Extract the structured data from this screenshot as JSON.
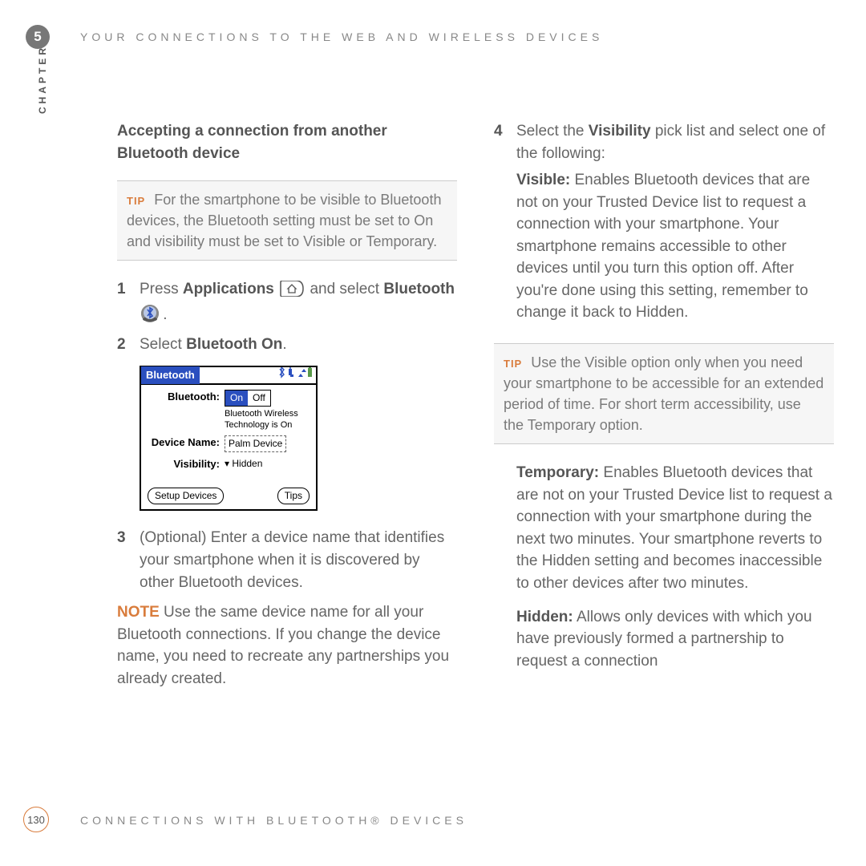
{
  "chapter_number": "5",
  "chapter_word": "CHAPTER",
  "running_header": "YOUR CONNECTIONS TO THE WEB AND WIRELESS DEVICES",
  "page_number": "130",
  "running_footer": "CONNECTIONS WITH BLUETOOTH® DEVICES",
  "left": {
    "heading": "Accepting a connection from another Bluetooth device",
    "tip_label": "TIP",
    "tip_text": "For the smartphone to be visible to Bluetooth devices, the Bluetooth setting must be set to On and visibility must be set to Visible or Temporary.",
    "step1_pre": "Press ",
    "step1_app": "Applications",
    "step1_mid": " and select ",
    "step1_bt": "Bluetooth",
    "step1_post": " .",
    "step2_pre": "Select ",
    "step2_strong": "Bluetooth On",
    "step2_post": ".",
    "step3_pre": "(Optional)    Enter a device name that identifies your smartphone when it is discovered by other Bluetooth devices.",
    "note_label": "NOTE",
    "note_text": " Use the same device name for all your Bluetooth connections. If you change the device name, you need to recreate any partnerships you already created.",
    "screen": {
      "title": "Bluetooth",
      "label_bt": "Bluetooth:",
      "on": "On",
      "off": "Off",
      "status_line1": "Bluetooth Wireless",
      "status_line2": "Technology is On",
      "label_devname": "Device Name:",
      "devname": "Palm Device",
      "label_vis": "Visibility:",
      "vis_value": "Hidden",
      "btn_setup": "Setup Devices",
      "btn_tips": "Tips"
    }
  },
  "right": {
    "step4_pre": "Select the ",
    "step4_strong": "Visibility",
    "step4_post": " pick list and select one of the following:",
    "visible_label": "Visible:",
    "visible_text": " Enables Bluetooth devices that are not on your Trusted Device list to request a connection with your smartphone. Your smartphone remains accessible to other devices until you turn this option off. After you're done using this setting, remember to change it back to Hidden.",
    "tip_label": "TIP",
    "tip_text": "Use the Visible option only when you need your smartphone to be accessible for an extended period of time. For short term accessibility, use the Temporary option.",
    "temp_label": "Temporary:",
    "temp_text": " Enables Bluetooth devices that are not on your Trusted Device list to request a connection with your smartphone during the next two minutes. Your smartphone reverts to the Hidden setting and becomes inaccessible to other devices after two minutes.",
    "hidden_label": "Hidden:",
    "hidden_text": " Allows only devices with which you have previously formed a partnership to request a connection"
  }
}
